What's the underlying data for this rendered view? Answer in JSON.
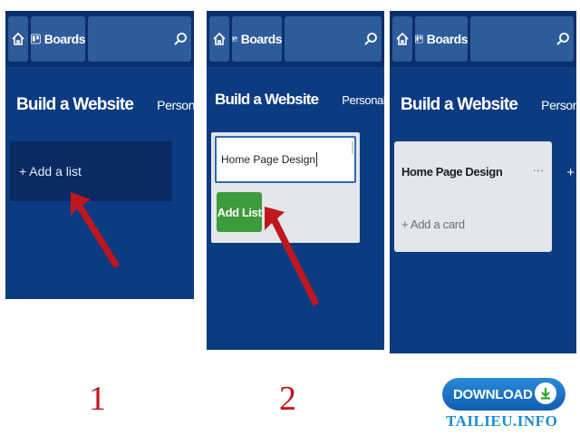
{
  "common": {
    "boards_label": "Boards",
    "board_title": "Build a Website",
    "team_label": "Personal"
  },
  "step1": {
    "add_list_text": "+ Add a list",
    "number": "1"
  },
  "step2": {
    "input_value": "Home Page Design",
    "add_list_button": "Add List",
    "number": "2"
  },
  "step3": {
    "list_title": "Home Page Design",
    "list_menu": "...",
    "add_card_text": "+ Add a card",
    "partial_add": "+"
  },
  "watermark": {
    "download_label": "DOWNLOAD",
    "site": "TAILIEU.INFO"
  },
  "colors": {
    "board_bg": "#0c3b82",
    "header_bg": "#0a2f6c",
    "button_bg": "#2e5c9b",
    "add_button": "#3c9b3a",
    "arrow": "#c0161e"
  }
}
